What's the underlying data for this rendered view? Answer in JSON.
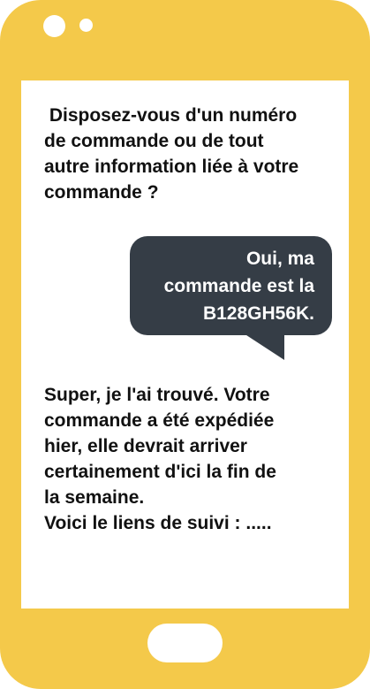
{
  "messages": {
    "incoming_1": {
      "lines": [
        " Disposez-vous d'un numéro",
        "de commande ou de tout",
        "autre information liée à votre",
        "commande ?"
      ]
    },
    "outgoing_1": {
      "lines": [
        "Oui, ma",
        "commande est la",
        "B128GH56K."
      ]
    },
    "incoming_2": {
      "lines": [
        "Super, je l'ai trouvé. Votre",
        "commande a été expédiée",
        "hier, elle devrait arriver",
        "certainement d'ici la fin de",
        "la semaine.",
        "Voici le liens de suivi : ....."
      ]
    }
  },
  "colors": {
    "phone_body": "#f4c94a",
    "screen": "#ffffff",
    "outgoing_bubble": "#353d46",
    "incoming_text": "#111111",
    "outgoing_text": "#ffffff"
  },
  "icons": {
    "camera": "camera-icon",
    "sensor": "sensor-icon",
    "home_button": "home-button"
  }
}
